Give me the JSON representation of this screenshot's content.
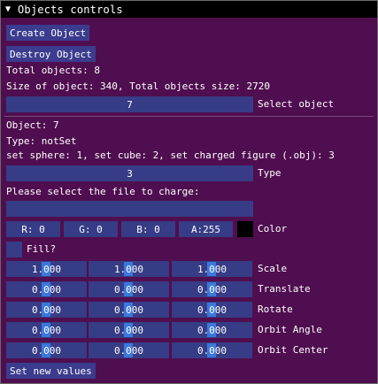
{
  "window": {
    "title": "Objects controls"
  },
  "buttons": {
    "create": "Create Object",
    "destroy": "Destroy Object",
    "set_values": "Set new values"
  },
  "stats": {
    "total_objects": "Total objects: 8",
    "sizes": "Size of object: 340, Total objects size: 2720"
  },
  "select": {
    "value": "7",
    "label": "Select object"
  },
  "object": {
    "name": "Object: 7",
    "type_text": "Type: notSet",
    "help": "set sphere: 1, set cube: 2, set charged figure (.obj): 3",
    "type_value": "3",
    "type_label": "Type",
    "file_prompt": "Please select the file to charge:",
    "file_value": ""
  },
  "color": {
    "r": "R:  0",
    "g": "G:  0",
    "b": "B:  0",
    "a": "A:255",
    "label": "Color",
    "swatch": "#000000"
  },
  "fill": {
    "label": "Fill?"
  },
  "rows": [
    {
      "label": "Scale",
      "values": [
        "1.000",
        "1.000",
        "1.000"
      ]
    },
    {
      "label": "Translate",
      "values": [
        "0.000",
        "0.000",
        "0.000"
      ]
    },
    {
      "label": "Rotate",
      "values": [
        "0.000",
        "0.000",
        "0.000"
      ]
    },
    {
      "label": "Orbit Angle",
      "values": [
        "0.000",
        "0.000",
        "0.000"
      ]
    },
    {
      "label": "Orbit Center",
      "values": [
        "0.000",
        "0.000",
        "0.000"
      ]
    }
  ]
}
